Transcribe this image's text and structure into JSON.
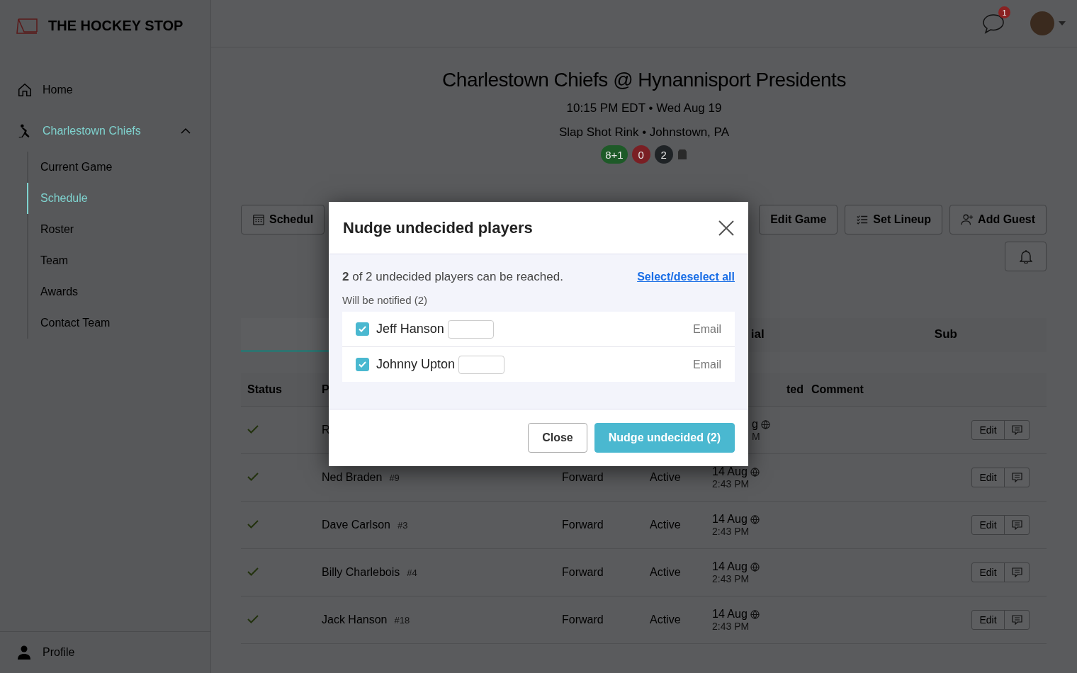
{
  "sidebar": {
    "brand": "THE HOCKEY STOP",
    "items": [
      {
        "label": "Home",
        "selected": false
      },
      {
        "label": "Charlestown Chiefs",
        "selected": true,
        "expanded": true,
        "children": [
          {
            "label": "Current Game",
            "selected": false
          },
          {
            "label": "Schedule",
            "selected": true
          },
          {
            "label": "Roster",
            "selected": false
          },
          {
            "label": "Team",
            "selected": false
          },
          {
            "label": "Awards",
            "selected": false
          },
          {
            "label": "Contact Team",
            "selected": false
          }
        ]
      }
    ],
    "footer": {
      "label": "Profile"
    }
  },
  "topbar": {
    "message_badge": "1"
  },
  "game": {
    "title": "Charlestown Chiefs @ Hynannisport Presidents",
    "time": "10:15 PM EDT • Wed Aug 19",
    "location": "Slap Shot Rink • Johnstown, PA",
    "badges": [
      {
        "label": "8+1",
        "color": "#1e5a28"
      },
      {
        "label": "0",
        "color": "#7a1f24"
      },
      {
        "label": "2",
        "color": "#1f2326"
      }
    ]
  },
  "toolbar": [
    "Schedul",
    "Edit Game",
    "Set Lineup",
    "Add Guest"
  ],
  "tabs": [
    {
      "selected": true
    },
    {
      "label": "ial",
      "selected": false
    },
    {
      "label": "Sub",
      "selected": false
    }
  ],
  "table": {
    "columns": [
      "Status",
      "P",
      "ted",
      "Comment"
    ],
    "rows": [
      {
        "kind": "partial",
        "name": "R",
        "date": "g",
        "time": "M",
        "action": "Edit"
      },
      {
        "kind": "full",
        "name": "Ned Braden",
        "number": "#9",
        "position": "Forward",
        "status": "Active",
        "date": "14 Aug",
        "time": "2:43 PM",
        "action": "Edit"
      },
      {
        "kind": "full",
        "name": "Dave Carlson",
        "number": "#3",
        "position": "Forward",
        "status": "Active",
        "date": "14 Aug",
        "time": "2:43 PM",
        "action": "Edit"
      },
      {
        "kind": "full",
        "name": "Billy Charlebois",
        "number": "#4",
        "position": "Forward",
        "status": "Active",
        "date": "14 Aug",
        "time": "2:43 PM",
        "action": "Edit"
      },
      {
        "kind": "full",
        "name": "Jack Hanson",
        "number": "#18",
        "position": "Forward",
        "status": "Active",
        "date": "14 Aug",
        "time": "2:43 PM",
        "action": "Edit"
      }
    ]
  },
  "modal": {
    "title": "Nudge undecided players",
    "summary": "**2** of 2 undecided players can be reached.",
    "select_all": "Select/deselect all",
    "group_label": "Will be notified (2)",
    "players": [
      {
        "name": "Jeff Hanson",
        "checked": true,
        "channel": "Email"
      },
      {
        "name": "Johnny Upton",
        "checked": true,
        "channel": "Email"
      }
    ],
    "buttons": [
      {
        "label": "Close",
        "kind": "secondary"
      },
      {
        "label": "Nudge undecided (2)",
        "kind": "primary"
      }
    ]
  }
}
